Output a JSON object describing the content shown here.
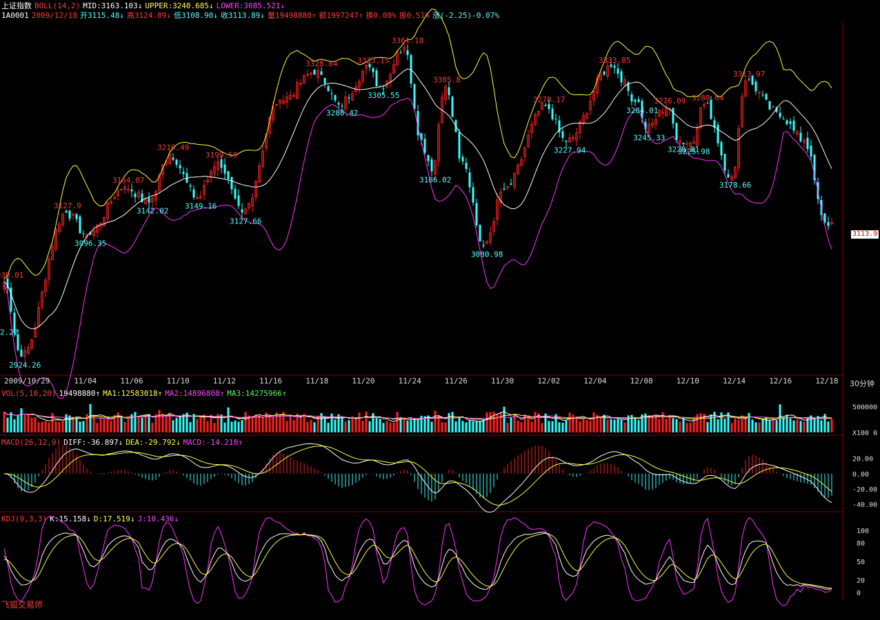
{
  "header": {
    "index_name": "上证指数",
    "boll_label": "BOLL(14,2)",
    "mid": "MID:3163.103↓",
    "upper": "UPPER:3240.685↓",
    "lower": "LOWER:3085.521↓",
    "code": "1A0001",
    "date": "2009/12/18",
    "open": "开3115.48↓",
    "high": "高3124.89↓",
    "low": "低3108.90↓",
    "close": "收3113.89↓",
    "volume": "量19498880↑",
    "amount": "额1997247↑",
    "turnover": "换0.00%",
    "amplitude": "振0.51%",
    "change": "涨(-2.25)-0.07%"
  },
  "vol_header": {
    "label": "VOL(5,10,20)",
    "value": "19498880↑",
    "ma1": "MA1:12583018↑",
    "ma2": "MA2:14896808↑",
    "ma3": "MA3:14275966↑"
  },
  "macd_header": {
    "label": "MACD(26,12,9)",
    "diff": "DIFF:-36.897↓",
    "dea": "DEA:-29.792↓",
    "macd": "MACD:-14.210↑"
  },
  "kdj_header": {
    "label": "KDJ(9,3,3)",
    "k": "K:15.158↓",
    "d": "D:17.519↓",
    "j": "J:10.436↓"
  },
  "timeframe": "30分钟",
  "current_price_tag": "3113.9",
  "brand": "飞狐交易师",
  "colors": {
    "up": "#ff2020",
    "down": "#33ffff",
    "upper": "#ffff44",
    "mid": "#ffffff",
    "lower": "#ff33ff",
    "ma2": "#ff66ff",
    "ma3": "#55ff55"
  },
  "chart_data": {
    "type": "candlestick",
    "main": {
      "ylim": [
        2900,
        3395
      ],
      "key_points": [
        {
          "i": 0,
          "v": 3030,
          "label": "3030.01"
        },
        {
          "i": 5,
          "v": 2924.26,
          "label": "2924.26"
        },
        {
          "i": 18,
          "v": 3127.9,
          "label": "3127.9"
        },
        {
          "i": 24,
          "v": 3096.35,
          "label": "3096.35"
        },
        {
          "i": 35,
          "v": 3164.07,
          "label": "3164.07"
        },
        {
          "i": 42,
          "v": 3142.02,
          "label": "3142.02"
        },
        {
          "i": 48,
          "v": 3210.49,
          "label": "3210.49"
        },
        {
          "i": 56,
          "v": 3149.16,
          "label": "3149.16"
        },
        {
          "i": 62,
          "v": 3199.59,
          "label": "3199.59"
        },
        {
          "i": 69,
          "v": 3127.66,
          "label": "3127.66"
        },
        {
          "i": 80,
          "v": 3287,
          "label": ""
        },
        {
          "i": 91,
          "v": 3328.84,
          "label": "3328.84"
        },
        {
          "i": 97,
          "v": 3280.42,
          "label": "3280.42"
        },
        {
          "i": 106,
          "v": 3333.15,
          "label": "3333.15"
        },
        {
          "i": 109,
          "v": 3305.55,
          "label": "3305.55"
        },
        {
          "i": 116,
          "v": 3361.18,
          "label": "3361.18"
        },
        {
          "i": 121,
          "v": 3230,
          "label": ""
        },
        {
          "i": 124,
          "v": 3186.02,
          "label": "3186.02"
        },
        {
          "i": 128,
          "v": 3305.8,
          "label": "3305.8"
        },
        {
          "i": 133,
          "v": 3200,
          "label": ""
        },
        {
          "i": 139,
          "v": 3080.98,
          "label": "3080.98"
        },
        {
          "i": 145,
          "v": 3160,
          "label": ""
        },
        {
          "i": 157,
          "v": 3278.17,
          "label": "3278.17"
        },
        {
          "i": 163,
          "v": 3227.94,
          "label": "3227.94"
        },
        {
          "i": 176,
          "v": 3333.85,
          "label": "3333.85"
        },
        {
          "i": 184,
          "v": 3284.01,
          "label": "3284.01"
        },
        {
          "i": 186,
          "v": 3245.33,
          "label": "3245.33"
        },
        {
          "i": 192,
          "v": 3276.09,
          "label": "3276.09"
        },
        {
          "i": 196,
          "v": 3228.81,
          "label": "3228.81"
        },
        {
          "i": 199,
          "v": 3225.98,
          "label": "3225.98"
        },
        {
          "i": 203,
          "v": 3280.64,
          "label": "3280.64"
        },
        {
          "i": 211,
          "v": 3178.66,
          "label": "3178.66"
        },
        {
          "i": 215,
          "v": 3313.97,
          "label": "3313.97"
        },
        {
          "i": 224,
          "v": 3270,
          "label": ""
        },
        {
          "i": 232,
          "v": 3230,
          "label": ""
        },
        {
          "i": 238,
          "v": 3114,
          "label": ""
        },
        {
          "i": 240,
          "v": 3113.89,
          "label": ""
        }
      ],
      "date_labels": [
        "2009/10/29",
        "11/04",
        "11/06",
        "11/10",
        "11/12",
        "11/16",
        "11/18",
        "11/20",
        "11/24",
        "11/26",
        "11/30",
        "12/02",
        "12/04",
        "12/08",
        "12/10",
        "12/14",
        "12/16",
        "12/18"
      ],
      "left_edge_label": "2.22"
    },
    "volume": {
      "ymax": 650000,
      "ticks": [
        {
          "v": 500000,
          "label": "500000"
        },
        {
          "v": 0,
          "label": "X100 0"
        }
      ]
    },
    "macd": {
      "ylim": [
        -48,
        35
      ],
      "ticks": [
        20,
        0,
        -20,
        -40
      ]
    },
    "kdj": {
      "ylim": [
        -10,
        110
      ],
      "ticks": [
        100,
        80,
        50,
        20,
        0
      ]
    }
  }
}
